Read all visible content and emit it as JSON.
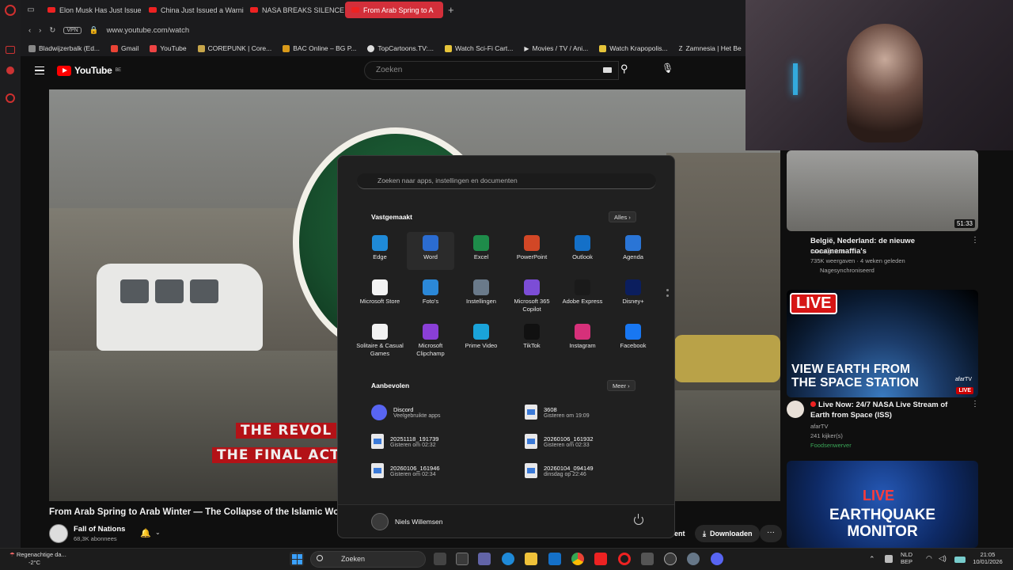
{
  "browser": {
    "tabs": [
      {
        "label": "Elon Musk Has Just Issue"
      },
      {
        "label": "China Just Issued a Warni"
      },
      {
        "label": "NASA BREAKS SILENCE o"
      },
      {
        "label": "From Arab Spring to A"
      }
    ],
    "vpn_label": "VPN",
    "url": "www.youtube.com/watch",
    "bookmarks": [
      "Bladwijzerbalk (Ed...",
      "Gmail",
      "YouTube",
      "COREPUNK | Core...",
      "BAC Online – BG P...",
      "TopCartoons.TV:...",
      "Watch Sci-Fi Cart...",
      "Movies / TV / Ani...",
      "Watch Krapopolis...",
      "Zamnesia | Het Be"
    ]
  },
  "youtube": {
    "logo": "YouTube",
    "region": "BE",
    "search_placeholder": "Zoeken",
    "video": {
      "caption_line1": "THE REVOL",
      "caption_line2": "THE FINAL ACT",
      "title": "From Arab Spring to Arab Winter — The Collapse of the Islamic World",
      "channel": "Fall of Nations",
      "subscribers": "68,3K abonnees",
      "action_partial": "ent",
      "download_label": "Downloaden",
      "more_label": "···"
    },
    "recommendations": [
      {
        "duration": "51:33",
        "title": "België, Nederland: de nieuwe cocaïnemaffia's",
        "channel": "Investigation",
        "meta": "735K weergaven · 4 weken geleden",
        "tag": "Nagesynchroniseerd"
      },
      {
        "badge": "LIVE",
        "thumb_text": "VIEW EARTH FROM THE SPACE STATION",
        "thumb_brand": "afarTV",
        "thumb_live": "LIVE",
        "title": "Live Now: 24/7 NASA Live Stream of Earth from Space (ISS)",
        "channel": "afarTV",
        "meta": "241 kijker(s)",
        "tag": "Foodsenwerver"
      },
      {
        "thumb_live": "LIVE",
        "thumb_text": "EARTHQUAKE MONITOR"
      }
    ]
  },
  "start_menu": {
    "search_placeholder": "Zoeken naar apps, instellingen en documenten",
    "pinned_title": "Vastgemaakt",
    "pinned_button": "Alles",
    "pinned": [
      {
        "label": "Edge",
        "icon": "edge-icon",
        "color": "#1f8ad8"
      },
      {
        "label": "Word",
        "icon": "word-icon",
        "color": "#2b6cd1"
      },
      {
        "label": "Excel",
        "icon": "excel-icon",
        "color": "#1e8c4a"
      },
      {
        "label": "PowerPoint",
        "icon": "powerpoint-icon",
        "color": "#d24726"
      },
      {
        "label": "Outlook",
        "icon": "outlook-icon",
        "color": "#1470c8"
      },
      {
        "label": "Agenda",
        "icon": "calendar-icon",
        "color": "#2a75d6"
      },
      {
        "label": "Microsoft Store",
        "icon": "store-icon",
        "color": "#f3f3f3"
      },
      {
        "label": "Foto's",
        "icon": "photos-icon",
        "color": "#2b88d8"
      },
      {
        "label": "Instellingen",
        "icon": "settings-icon",
        "color": "#6a7a8a"
      },
      {
        "label": "Microsoft 365 Copilot",
        "icon": "copilot-icon",
        "color": "#7c4dd6"
      },
      {
        "label": "Adobe Express",
        "icon": "adobe-express-icon",
        "color": "#1a1a1a"
      },
      {
        "label": "Disney+",
        "icon": "disney-icon",
        "color": "#0b1e5e"
      },
      {
        "label": "Solitaire & Casual Games",
        "icon": "solitaire-icon",
        "color": "#f2f2f2"
      },
      {
        "label": "Microsoft Clipchamp",
        "icon": "clipchamp-icon",
        "color": "#8a3fd6"
      },
      {
        "label": "Prime Video",
        "icon": "prime-video-icon",
        "color": "#1aa3d9"
      },
      {
        "label": "TikTok",
        "icon": "tiktok-icon",
        "color": "#111111"
      },
      {
        "label": "Instagram",
        "icon": "instagram-icon",
        "color": "#d6307a"
      },
      {
        "label": "Facebook",
        "icon": "facebook-icon",
        "color": "#1877f2"
      }
    ],
    "recommended_title": "Aanbevolen",
    "recommended_button": "Meer",
    "recommended": [
      {
        "name": "Discord",
        "sub": "Veelgebruikte apps",
        "icon": "discord-icon"
      },
      {
        "name": "3608",
        "sub": "Gisteren om 19:09",
        "icon": "image-file-icon"
      },
      {
        "name": "20251118_191739",
        "sub": "Gisteren om 02:32",
        "icon": "image-file-icon"
      },
      {
        "name": "20260106_161932",
        "sub": "Gisteren om 02:33",
        "icon": "image-file-icon"
      },
      {
        "name": "20260106_161946",
        "sub": "Gisteren om 02:34",
        "icon": "image-file-icon"
      },
      {
        "name": "20260104_094149",
        "sub": "dinsdag op 22:46",
        "icon": "image-file-icon"
      }
    ],
    "user_name": "Niels Willemsen"
  },
  "taskbar": {
    "weather_line1": "Regenachtige da...",
    "weather_line2": "-2°C",
    "search_label": "Zoeken",
    "lang_line1": "NLD",
    "lang_line2": "BEP",
    "time": "21:05",
    "date": "10/01/2026"
  }
}
